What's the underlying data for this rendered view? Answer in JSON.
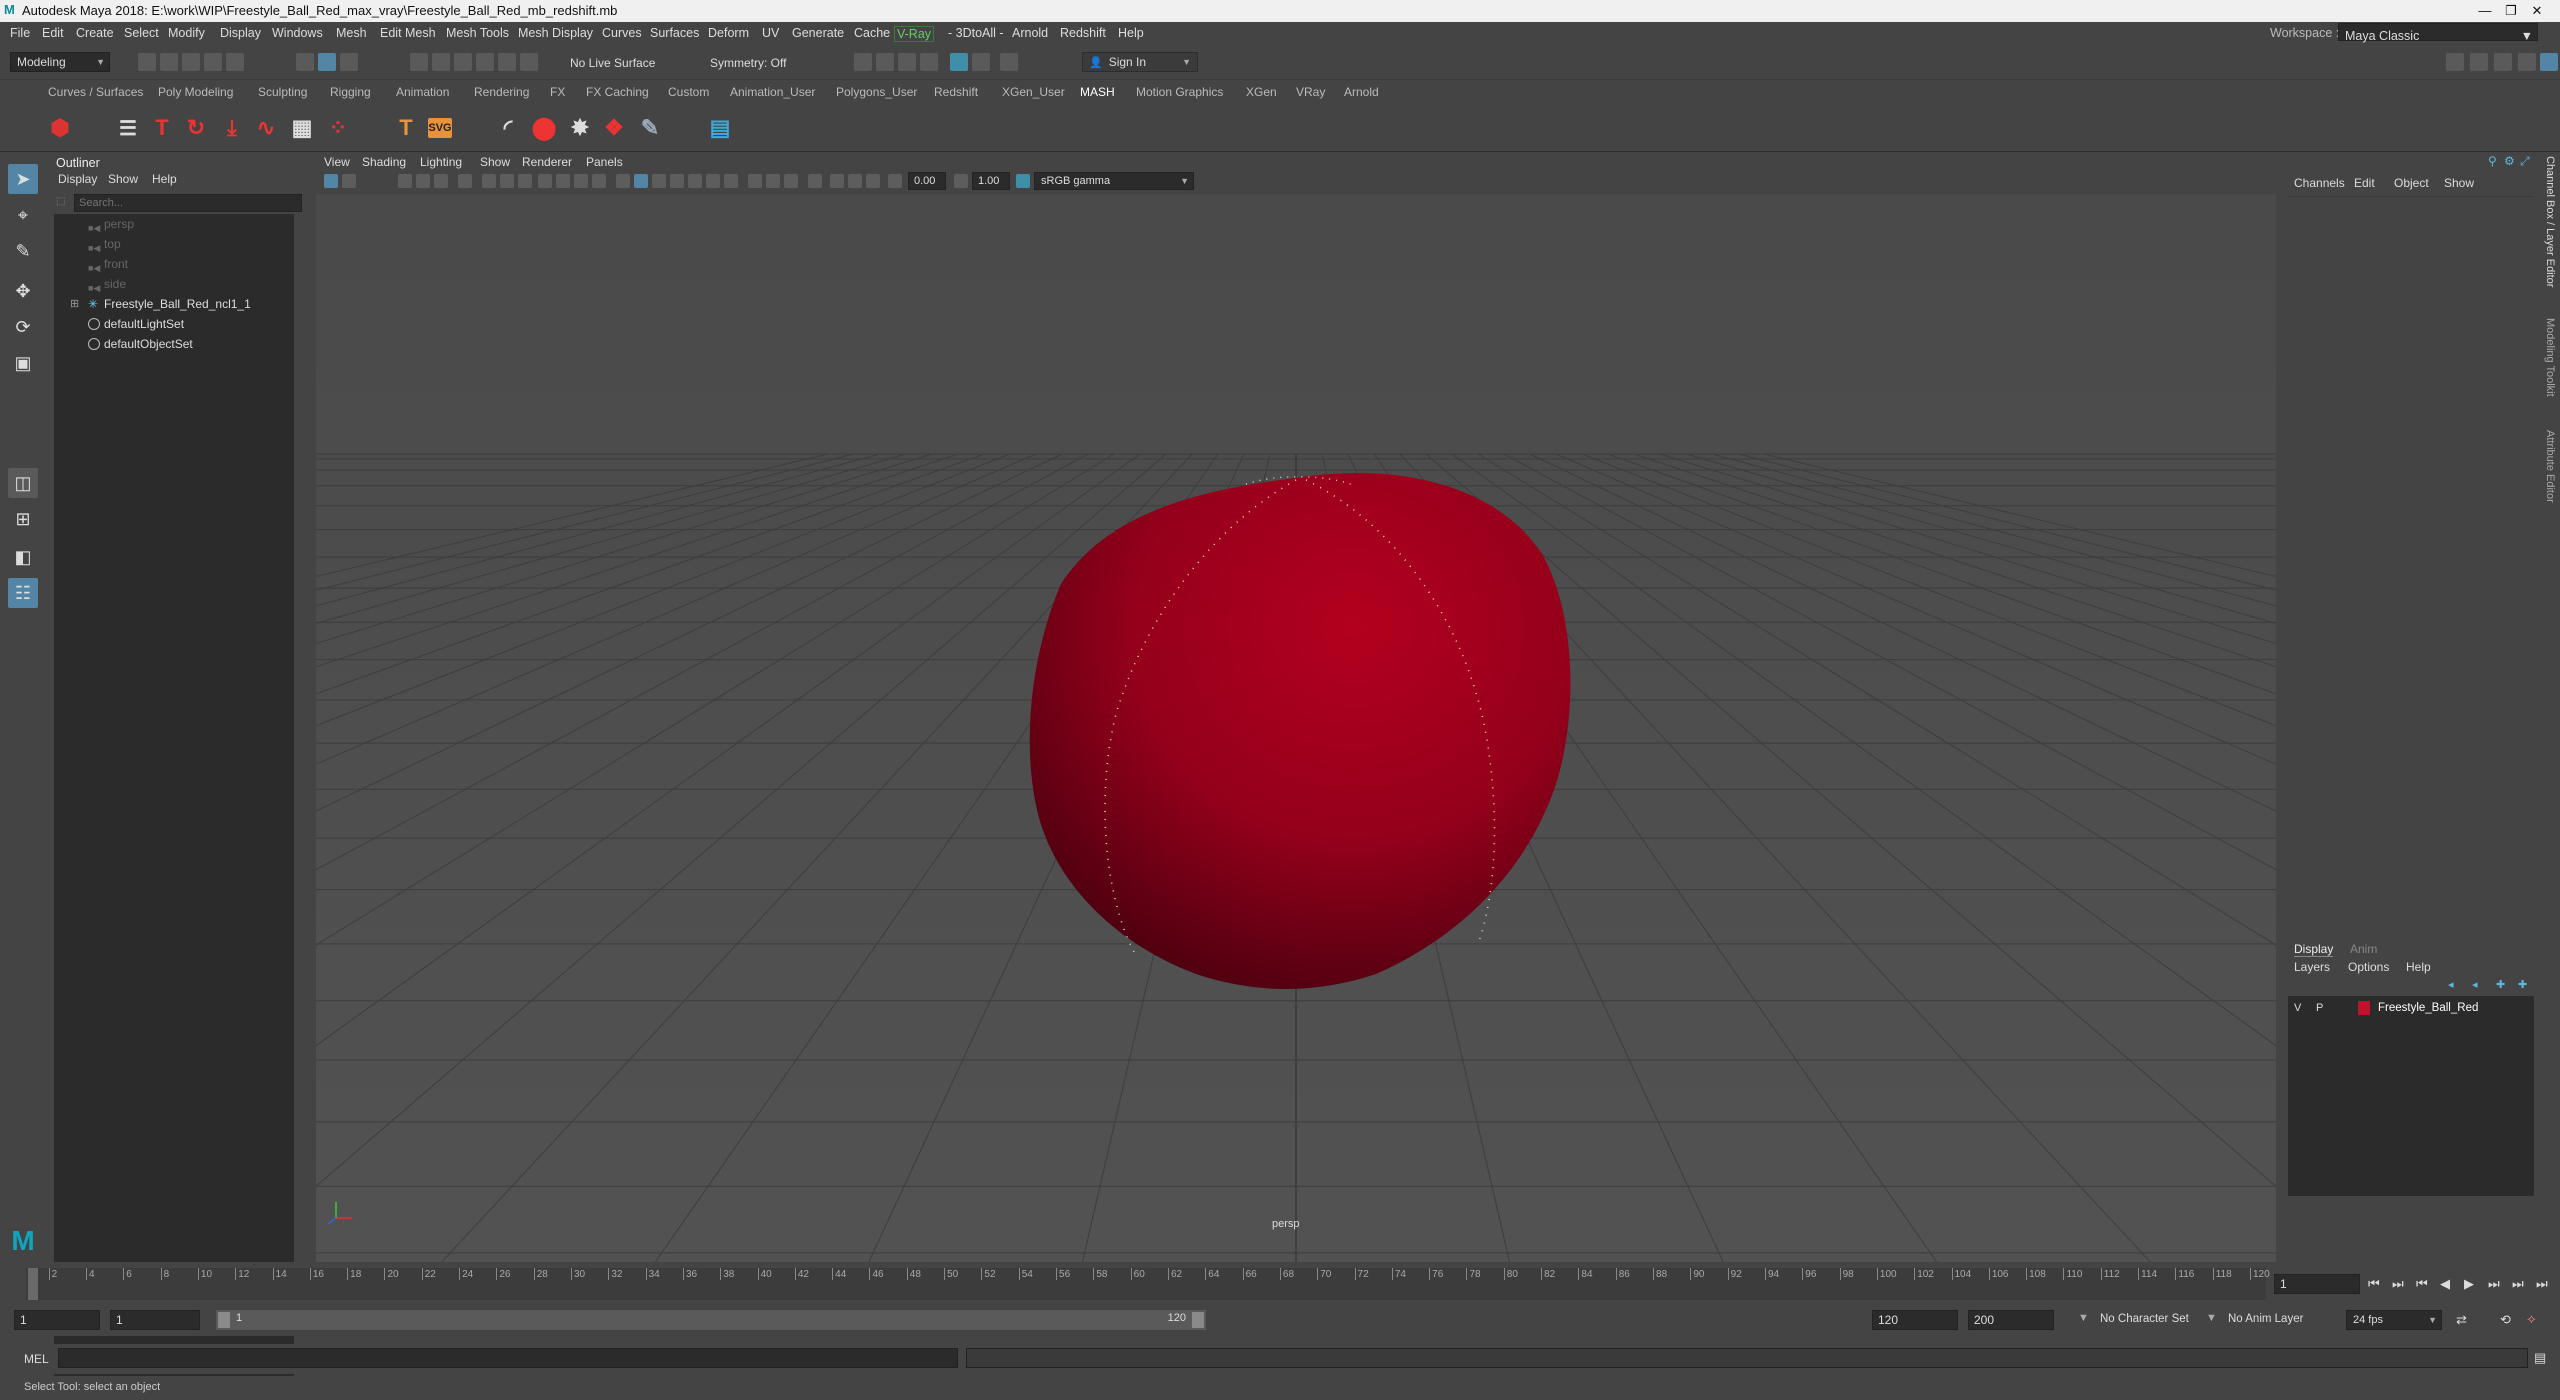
{
  "titlebar": {
    "title": "Autodesk Maya 2018: E:\\work\\WIP\\Freestyle_Ball_Red_max_vray\\Freestyle_Ball_Red_mb_redshift.mb",
    "logo": "M",
    "minimize": "—",
    "restore": "❐",
    "close": "✕"
  },
  "menubar": {
    "items": [
      "File",
      "Edit",
      "Create",
      "Select",
      "Modify",
      "Display",
      "Windows",
      "Mesh",
      "Edit Mesh",
      "Mesh Tools",
      "Mesh Display",
      "Curves",
      "Surfaces",
      "Deform",
      "UV",
      "Generate",
      "Cache",
      "V-Ray",
      "- 3DtoAll -",
      "Arnold",
      "Redshift",
      "Help"
    ],
    "workspace_label": "Workspace :",
    "workspace_value": "Maya Classic"
  },
  "statusline": {
    "mode": "Modeling",
    "live_surface": "No Live Surface",
    "symmetry": "Symmetry: Off",
    "sign_in": "Sign In"
  },
  "shelf_tabs": [
    "Curves / Surfaces",
    "Poly Modeling",
    "Sculpting",
    "Rigging",
    "Animation",
    "Rendering",
    "FX",
    "FX Caching",
    "Custom",
    "Animation_User",
    "Polygons_User",
    "Redshift",
    "XGen_User",
    "MASH",
    "Motion Graphics",
    "XGen",
    "VRay",
    "Arnold"
  ],
  "shelf_active": "MASH",
  "outliner": {
    "title": "Outliner",
    "menu": [
      "Display",
      "Show",
      "Help"
    ],
    "search_placeholder": "Search...",
    "items": [
      {
        "label": "persp",
        "dim": true
      },
      {
        "label": "top",
        "dim": true
      },
      {
        "label": "front",
        "dim": true
      },
      {
        "label": "side",
        "dim": true
      },
      {
        "label": "Freestyle_Ball_Red_ncl1_1",
        "dim": false
      },
      {
        "label": "defaultLightSet",
        "dim": false
      },
      {
        "label": "defaultObjectSet",
        "dim": false
      }
    ]
  },
  "viewport": {
    "menu": [
      "View",
      "Shading",
      "Lighting",
      "Show",
      "Renderer",
      "Panels"
    ],
    "exposure": "0.00",
    "gamma": "1.00",
    "colorspace": "sRGB gamma",
    "camera_label": "persp",
    "ball_color": "#a0001c"
  },
  "channelbox": {
    "menu": [
      "Channels",
      "Edit",
      "Object",
      "Show"
    ]
  },
  "layer_editor": {
    "tabs": [
      "Display",
      "Anim"
    ],
    "menu": [
      "Layers",
      "Options",
      "Help"
    ],
    "layer": {
      "v": "V",
      "p": "P",
      "name": "Freestyle_Ball_Red",
      "color": "#c0122a"
    }
  },
  "side_tabs": [
    "Channel Box / Layer Editor",
    "Modeling Toolkit",
    "Attribute Editor"
  ],
  "timeline": {
    "ticks": [
      "1",
      "2",
      "4",
      "6",
      "8",
      "10",
      "12",
      "14",
      "16",
      "18",
      "20",
      "22",
      "24",
      "26",
      "28",
      "30",
      "32",
      "34",
      "36",
      "38",
      "40",
      "42",
      "44",
      "46",
      "48",
      "50",
      "52",
      "54",
      "56",
      "58",
      "60",
      "62",
      "64",
      "66",
      "68",
      "70",
      "72",
      "74",
      "76",
      "78",
      "80",
      "82",
      "84",
      "86",
      "88",
      "90",
      "92",
      "94",
      "96",
      "98",
      "100",
      "102",
      "104",
      "106",
      "108",
      "110",
      "112",
      "114",
      "116",
      "118",
      "120"
    ],
    "current_frame": "1"
  },
  "range": {
    "start": "1",
    "start2": "1",
    "slider_start": "1",
    "slider_end": "120",
    "end": "120",
    "end2": "200",
    "character_set": "No Character Set",
    "anim_layer": "No Anim Layer",
    "fps": "24 fps"
  },
  "cmdline": {
    "label": "MEL"
  },
  "helpline": {
    "text": "Select Tool: select an object"
  }
}
